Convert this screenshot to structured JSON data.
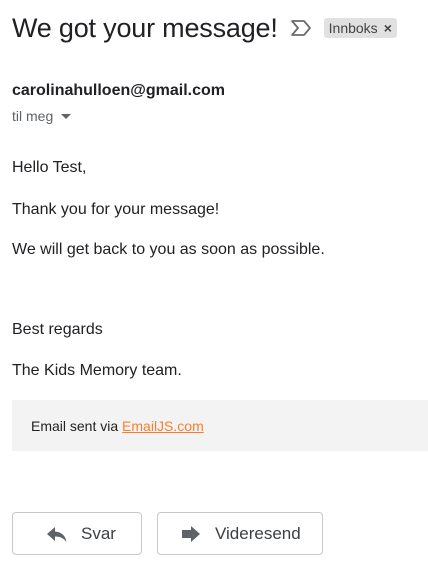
{
  "email": {
    "subject": "We got your message!",
    "label": "Innboks",
    "label_close": "×",
    "sender": "carolinahulloen@gmail.com",
    "recipient": "til meg",
    "body_lines": [
      "Hello Test,",
      "Thank you for your message!",
      "We will get back to you as soon as possible.",
      "Best regards",
      "The Kids Memory team."
    ],
    "footer_prefix": "Email sent via ",
    "footer_link_text": "EmailJS.com"
  },
  "actions": {
    "reply_label": "Svar",
    "forward_label": "Videresend"
  },
  "icons": {
    "important": "important-marker-icon",
    "caret": "caret-down-icon",
    "reply": "reply-arrow-icon",
    "forward": "forward-arrow-icon"
  },
  "colors": {
    "text": "#202124",
    "muted": "#5f6368",
    "chip_bg": "#e1e1e1",
    "footer_bg": "#f3f3f3",
    "link": "#ff7b2b",
    "button_border": "#c8c8c8"
  }
}
